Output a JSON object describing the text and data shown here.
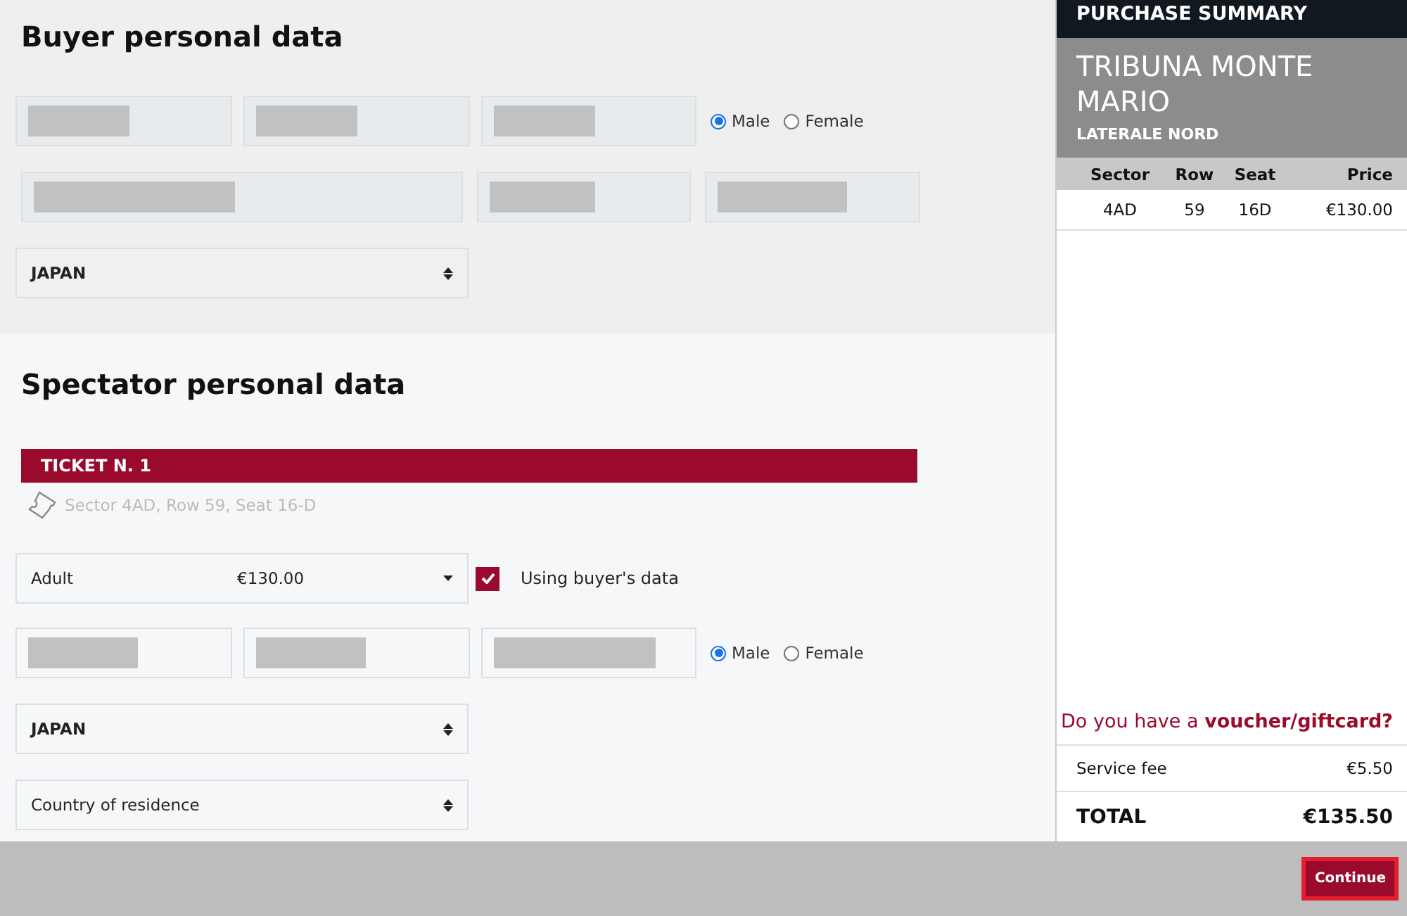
{
  "buyer": {
    "title": "Buyer personal data",
    "field_rows": [
      [
        {
          "redacted": true
        },
        {
          "redacted": true
        },
        {
          "redacted": true
        }
      ],
      [
        {
          "redacted": true
        },
        {
          "redacted": true
        },
        {
          "redacted": true
        }
      ]
    ],
    "gender": [
      {
        "label": "Male",
        "selected": true
      },
      {
        "label": "Female",
        "selected": false
      }
    ],
    "nationality": {
      "value": "JAPAN"
    }
  },
  "spectator": {
    "title": "Spectator personal data",
    "ticket": {
      "title": "TICKET N. 1",
      "seat": "Sector 4AD, Row 59, Seat 16-D"
    },
    "ticket_type": {
      "value": "Adult",
      "price": "€130.00"
    },
    "use_buyer_data": {
      "label": "Using buyer's data",
      "checked": true
    },
    "fields": [
      {
        "redacted": true
      },
      {
        "redacted": true
      },
      {
        "redacted": true
      }
    ],
    "gender": [
      {
        "label": "Male",
        "selected": true
      },
      {
        "label": "Female",
        "selected": false
      }
    ],
    "nationality": {
      "value": "JAPAN"
    },
    "residence": {
      "placeholder": "Country of residence"
    }
  },
  "summary": {
    "header": "PURCHASE SUMMARY",
    "venue": "TRIBUNA MONTE MARIO",
    "section": "LATERALE NORD",
    "columns": [
      "Sector",
      "Row",
      "Seat",
      "Price"
    ],
    "rows": [
      [
        "4AD",
        "59",
        "16D",
        "€130.00"
      ]
    ],
    "voucher": "Do you have a **voucher/giftcard?**",
    "fee": {
      "label": "Service fee",
      "value": "€5.50"
    },
    "total": {
      "label": "TOTAL",
      "value": "€135.50"
    }
  },
  "footer": {
    "continue": "Continue"
  }
}
